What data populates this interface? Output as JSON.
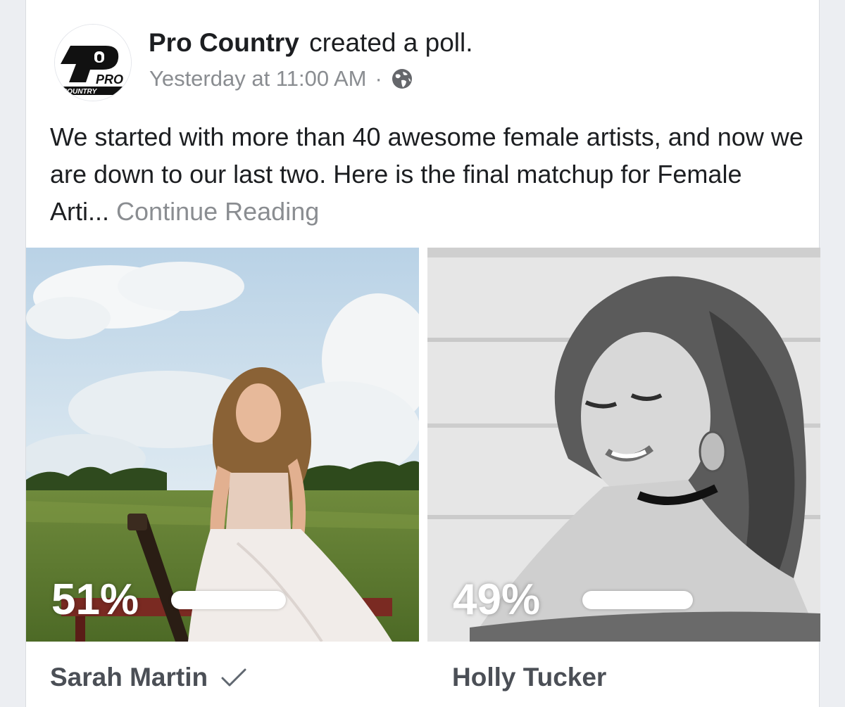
{
  "post": {
    "page_name": "Pro Country",
    "action_text": "created a poll.",
    "timestamp": "Yesterday at 11:00 AM",
    "separator": "·",
    "audience_icon": "globe-icon",
    "avatar_logo_text": "PRO",
    "avatar_logo_subtext": "COUNTRY",
    "body_text": "We started with more than 40 awesome female artists, and now we are down to our last two. Here is the final matchup for Female Arti...",
    "continue_label": "Continue Reading"
  },
  "poll": {
    "options": [
      {
        "name": "Sarah Martin",
        "percent_label": "51%",
        "percent": 51,
        "selected": true,
        "selected_icon": "checkmark-icon"
      },
      {
        "name": "Holly Tucker",
        "percent_label": "49%",
        "percent": 49,
        "selected": false
      }
    ]
  },
  "colors": {
    "text_primary": "#1c1e21",
    "text_secondary": "#8a8d91",
    "option_label": "#4b4f56",
    "card_bg": "#ffffff",
    "page_bg": "#eceef2"
  }
}
